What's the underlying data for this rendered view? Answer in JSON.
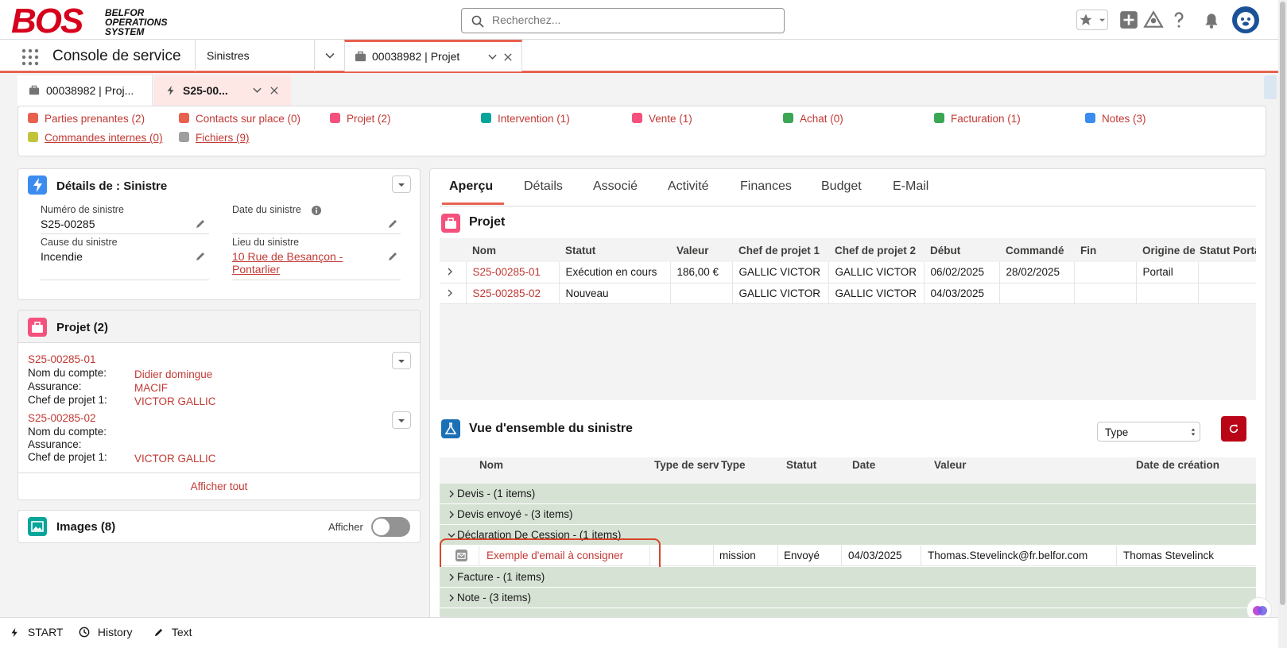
{
  "header": {
    "logo_text": "BOS",
    "logo_subtitle": "BELFOR OPERATIONS SYSTEM",
    "search_placeholder": "Recherchez..."
  },
  "console": {
    "app_name": "Console de service",
    "nav_label": "Sinistres",
    "active_tab": "00038982 | Projet"
  },
  "subtabs": [
    {
      "label": "00038982 | Proj..."
    },
    {
      "label": "S25-00..."
    }
  ],
  "highlights": [
    {
      "label": "Parties prenantes (2)",
      "color": "#e8614f"
    },
    {
      "label": "Contacts sur place (0)",
      "color": "#e8614f"
    },
    {
      "label": "Projet (2)",
      "color": "#f5517d"
    },
    {
      "label": "Intervention (1)",
      "color": "#06a59a"
    },
    {
      "label": "Vente (1)",
      "color": "#f5517d"
    },
    {
      "label": "Achat (0)",
      "color": "#3ba755"
    },
    {
      "label": "Facturation (1)",
      "color": "#3ba755"
    },
    {
      "label": "Notes (3)",
      "color": "#3c8cf0"
    },
    {
      "label": "Commandes internes (0)",
      "color": "#c1c43a"
    },
    {
      "label": "Fichiers (9)",
      "color": "#9e9e9e"
    }
  ],
  "details": {
    "title": "Détails de : Sinistre",
    "numero_label": "Numéro de sinistre",
    "numero_value": "S25-00285",
    "date_label": "Date du sinistre",
    "cause_label": "Cause du sinistre",
    "cause_value": "Incendie",
    "lieu_label": "Lieu du sinistre",
    "lieu_value_1": "10 Rue de Besançon -",
    "lieu_value_2": "Pontarlier"
  },
  "projet_card": {
    "title": "Projet (2)",
    "items": [
      {
        "id": "S25-00285-01",
        "compte_label": "Nom du compte:",
        "compte": "Didier domingue",
        "assurance_label": "Assurance:",
        "assurance": "MACIF",
        "chef_label": "Chef de projet 1:",
        "chef": "VICTOR GALLIC"
      },
      {
        "id": "S25-00285-02",
        "compte_label": "Nom du compte:",
        "compte": "",
        "assurance_label": "Assurance:",
        "assurance": "",
        "chef_label": "Chef de projet 1:",
        "chef": "VICTOR GALLIC"
      }
    ],
    "show_all": "Afficher tout"
  },
  "images_card": {
    "title": "Images (8)",
    "toggle_label": "Afficher"
  },
  "main_tabs": [
    "Aperçu",
    "Détails",
    "Associé",
    "Activité",
    "Finances",
    "Budget",
    "E-Mail"
  ],
  "projet_table": {
    "title": "Projet",
    "headers": [
      "Nom",
      "Statut",
      "Valeur",
      "Chef de projet 1",
      "Chef de projet 2",
      "Début",
      "Commandé",
      "Fin",
      "Origine de l",
      "Statut Porta"
    ],
    "rows": [
      [
        "S25-00285-01",
        "Exécution en cours",
        "186,00 €",
        "GALLIC VICTOR",
        "GALLIC VICTOR",
        "06/02/2025",
        "28/02/2025",
        "",
        "Portail",
        ""
      ],
      [
        "S25-00285-02",
        "Nouveau",
        "",
        "GALLIC VICTOR",
        "GALLIC VICTOR",
        "04/03/2025",
        "",
        "",
        "",
        ""
      ]
    ]
  },
  "vue": {
    "title": "Vue d'ensemble du sinistre",
    "select_value": "Type",
    "headers": [
      "Nom",
      "Type de serv",
      "Type",
      "Statut",
      "Date",
      "Valeur",
      "Date de création"
    ],
    "groups": [
      "Devis - (1 items)",
      "Devis envoyé - (3 items)",
      "Déclaration De Cession - (1 items)",
      "Facture - (1 items)",
      "Note - (3 items)"
    ],
    "email_row": {
      "name": "Exemple d'email à consigner",
      "type_serv": "",
      "type": "mission",
      "statut": "Envoyé",
      "date": "04/03/2025",
      "valeur": "Thomas.Stevelinck@fr.belfor.com",
      "creation": "Thomas Stevelinck"
    }
  },
  "bottom": {
    "start": "START",
    "history": "History",
    "text": "Text"
  }
}
